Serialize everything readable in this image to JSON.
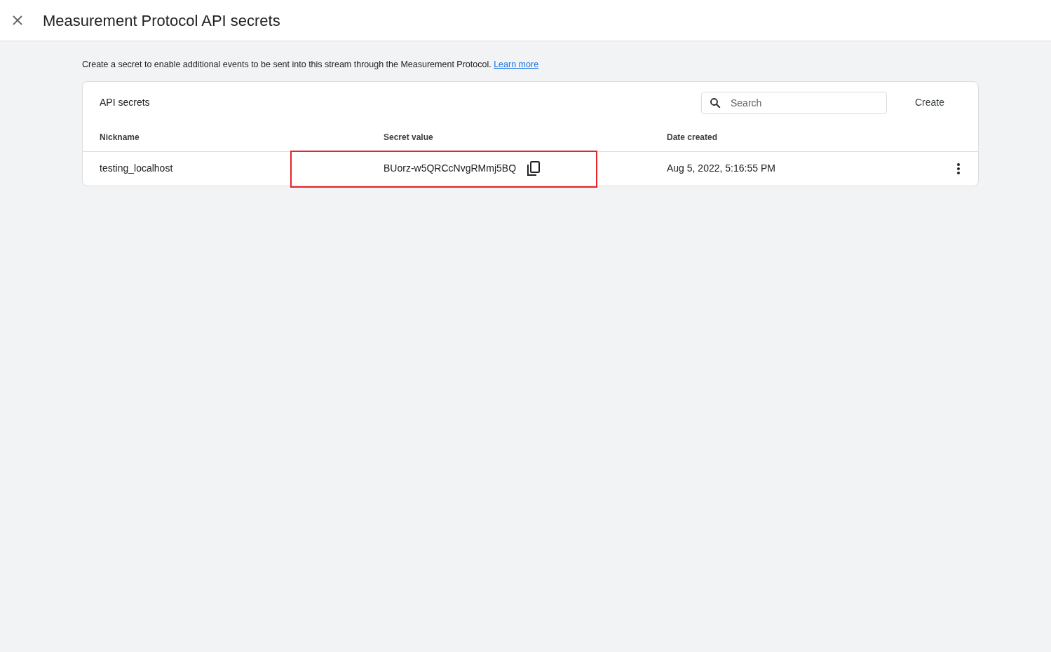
{
  "header": {
    "title": "Measurement Protocol API secrets"
  },
  "intro": {
    "text": "Create a secret to enable additional events to be sent into this stream through the Measurement Protocol.",
    "link": "Learn more"
  },
  "card": {
    "title": "API secrets",
    "search": {
      "placeholder": "Search"
    },
    "create_button": "Create",
    "columns": [
      "Nickname",
      "Secret value",
      "Date created"
    ],
    "rows": [
      {
        "nickname": "testing_localhost",
        "secret": "BUorz-w5QRCcNvgRMmj5BQ",
        "date_created": "Aug 5, 2022, 5:16:55 PM",
        "secret_highlighted": true
      }
    ]
  }
}
